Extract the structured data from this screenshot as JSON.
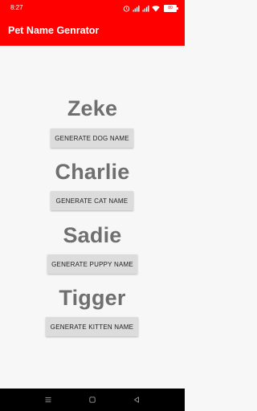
{
  "status": {
    "time": "8:27",
    "battery": "80"
  },
  "app": {
    "title": "Pet Name Genrator"
  },
  "pets": [
    {
      "name": "Zeke",
      "button": "GENERATE DOG NAME"
    },
    {
      "name": "Charlie",
      "button": "GENERATE CAT NAME"
    },
    {
      "name": "Sadie",
      "button": "GENERATE PUPPY NAME"
    },
    {
      "name": "Tigger",
      "button": "GENERATE KITTEN NAME"
    }
  ],
  "icons": {
    "alarm": "alarm-icon",
    "signal": "signal-icon",
    "wifi": "wifi-icon",
    "battery": "battery-icon",
    "nav_menu": "menu-icon",
    "nav_home": "home-icon",
    "nav_back": "back-icon"
  },
  "colors": {
    "accent": "#ff0000",
    "name_text": "#6f6f6f",
    "button_bg": "#dcdcdc"
  }
}
